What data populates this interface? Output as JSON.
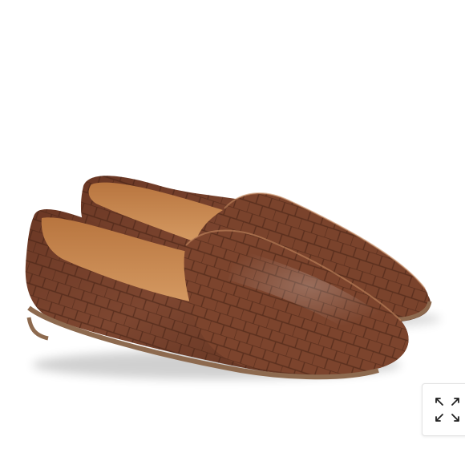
{
  "product_image": {
    "subject": "loafer-pair",
    "colors": {
      "background": "#ffffff",
      "leather": "#74402a",
      "leather_dark": "#4f2818",
      "lining": "#c98a55",
      "sole": "#8d6a4f"
    }
  },
  "expand_button": {
    "icon": "expand-icon",
    "colors": {
      "border": "#e3e3e3",
      "icon": "#222222"
    }
  }
}
